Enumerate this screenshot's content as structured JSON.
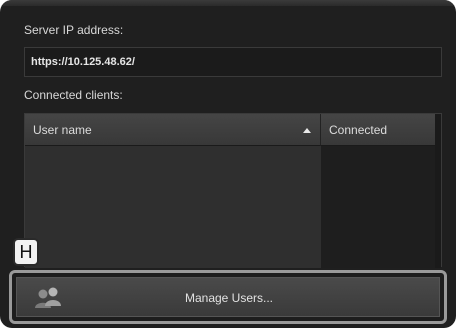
{
  "server": {
    "ip_label": "Server IP address:",
    "ip_value": "https://10.125.48.62/"
  },
  "clients": {
    "label": "Connected clients:",
    "columns": [
      "User name",
      "Connected"
    ],
    "sort_column": "User name",
    "sort_direction": "ascending"
  },
  "callout": {
    "marker": "H"
  },
  "actions": {
    "manage_users_label": "Manage Users..."
  },
  "icons": {
    "sort": "sort-ascending-icon",
    "manage_users": "users-icon"
  }
}
